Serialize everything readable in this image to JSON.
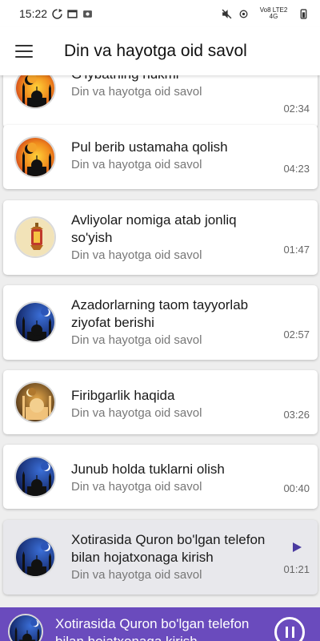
{
  "status": {
    "time": "15:22",
    "network": "Vo8 LTE2 4G"
  },
  "app": {
    "title": "Din va hayotga oid savol"
  },
  "items": [
    {
      "title": "G'iybatning hukmi",
      "subtitle": "Din va hayotga oid savol",
      "duration": "02:34",
      "icon": "crescent-mosque-icon"
    },
    {
      "title": "Pul berib ustamaha qolish",
      "subtitle": "Din va hayotga oid savol",
      "duration": "04:23",
      "icon": "crescent-mosque-icon"
    },
    {
      "title": "Avliyolar nomiga atab jonliq so'yish",
      "subtitle": "Din va hayotga oid savol",
      "duration": "01:47",
      "icon": "lantern-icon"
    },
    {
      "title": "Azadorlarning taom tayyorlab ziyofat berishi",
      "subtitle": "Din va hayotga oid savol",
      "duration": "02:57",
      "icon": "night-mosque-icon"
    },
    {
      "title": "Firibgarlik haqida",
      "subtitle": "Din va hayotga oid savol",
      "duration": "03:26",
      "icon": "golden-mosque-icon"
    },
    {
      "title": "Junub holda tuklarni olish",
      "subtitle": "Din va hayotga oid savol",
      "duration": "00:40",
      "icon": "night-mosque-icon"
    },
    {
      "title": "Xotirasida Quron bo'lgan telefon bilan hojatxonaga kirish",
      "subtitle": "Din va hayotga oid savol",
      "duration": "01:21",
      "icon": "night-mosque-icon"
    }
  ],
  "player": {
    "title": "Xotirasida Quron bo'lgan telefon bilan hojatxonaga kirish"
  },
  "colors": {
    "player_bg": "#6a4bbd",
    "play_accent": "#4a3aa0"
  }
}
